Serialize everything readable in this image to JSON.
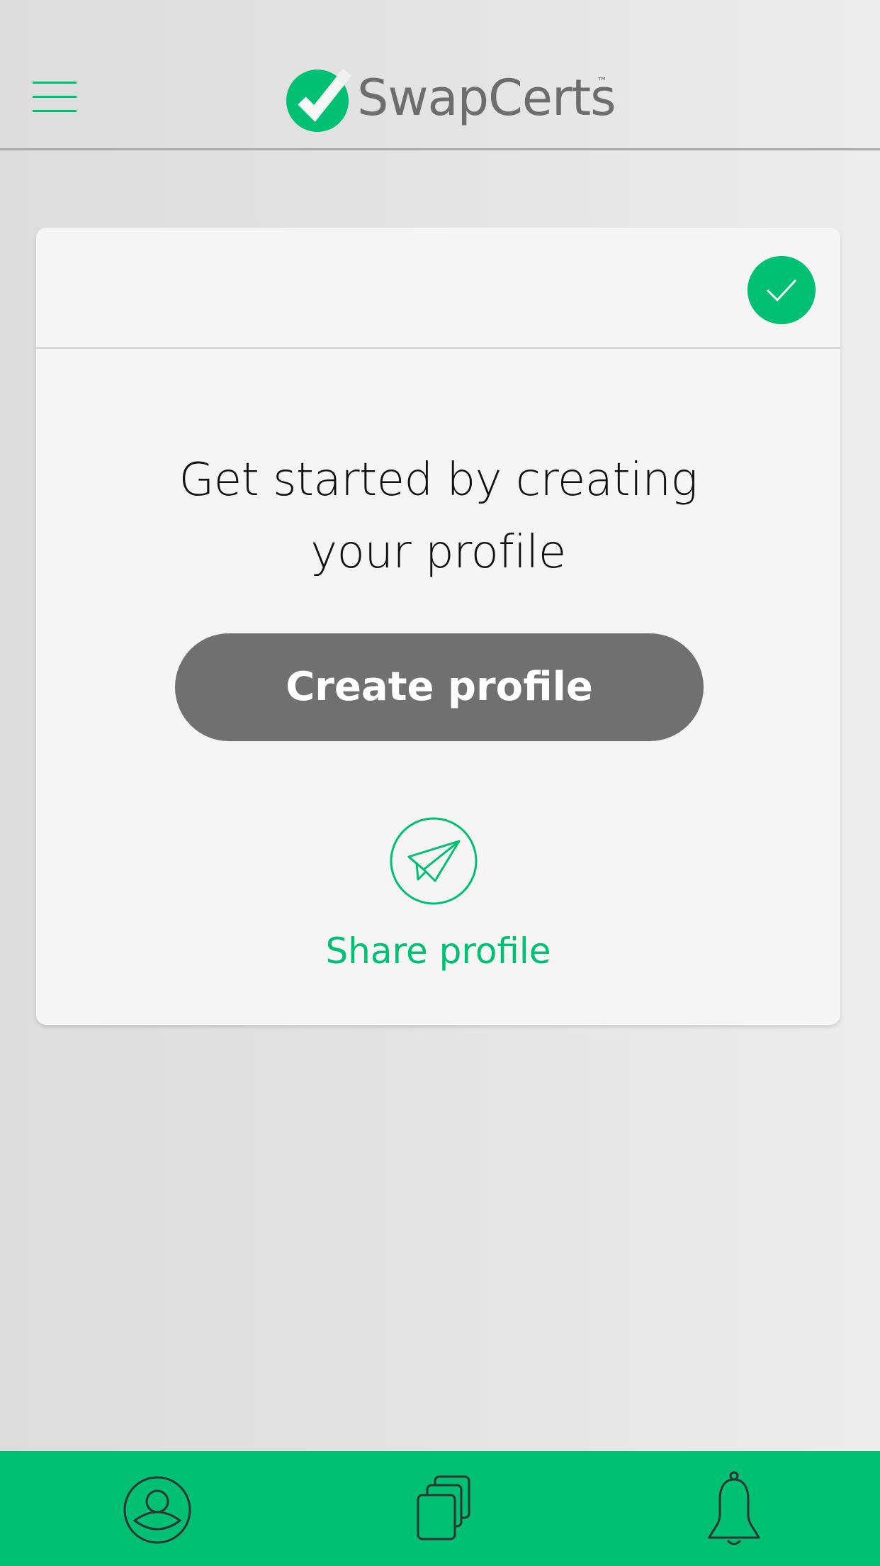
{
  "header": {
    "menu_icon": "hamburger-menu-icon",
    "logo_text": "SwapCerts",
    "logo_tm": "™"
  },
  "card": {
    "status_icon": "check-icon",
    "headline_line1": "Get started by creating",
    "headline_line2": "your profile",
    "create_button_label": "Create profile",
    "share_icon": "paper-plane-icon",
    "share_label": "Share profile"
  },
  "bottom_nav": {
    "items": [
      {
        "icon": "profile-icon"
      },
      {
        "icon": "certificates-stack-icon"
      },
      {
        "icon": "bell-icon"
      }
    ]
  },
  "colors": {
    "accent": "#00c074",
    "button": "#707070",
    "card": "#f5f5f5",
    "logo_text": "#6d6d6d"
  }
}
